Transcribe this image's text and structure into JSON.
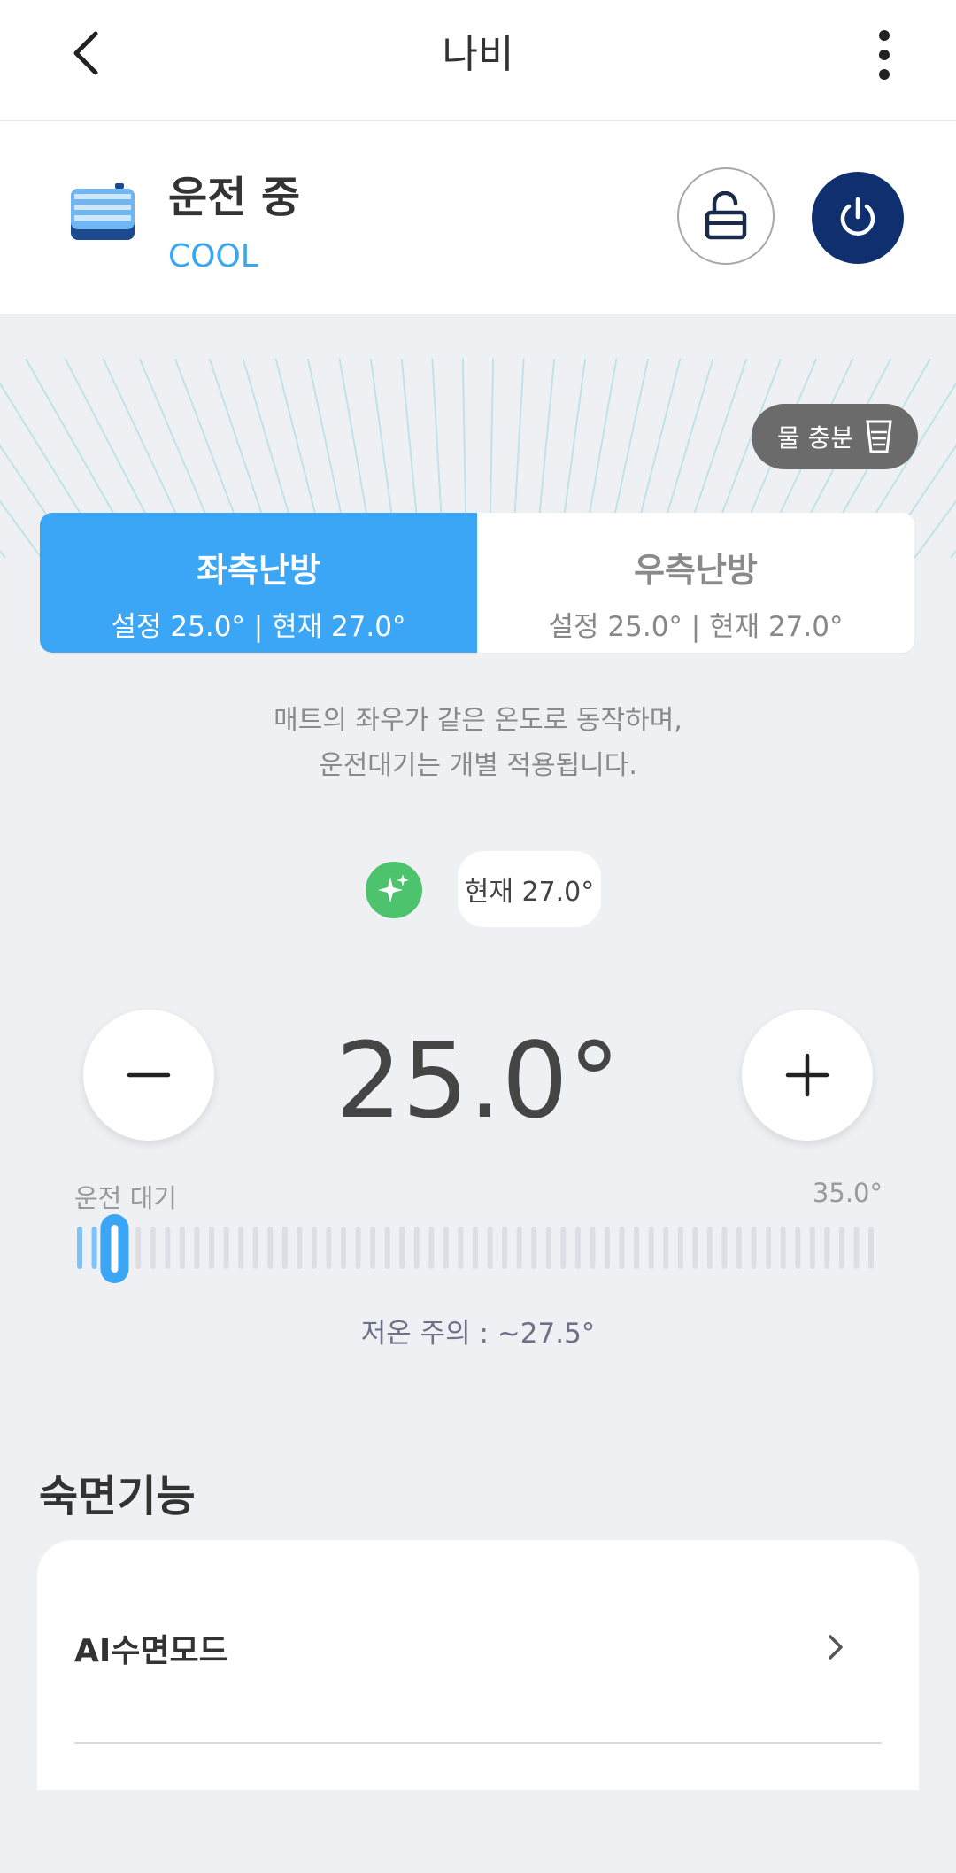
{
  "header": {
    "title": "나비",
    "back_icon": "chevron-left-icon",
    "menu_icon": "more-vertical-icon"
  },
  "status": {
    "state": "운전 중",
    "mode": "COOL",
    "device_icon": "mattress-icon",
    "lock_icon": "unlock-icon",
    "power_icon": "power-icon"
  },
  "water": {
    "label": "물 충분",
    "icon": "water-cup-icon"
  },
  "tabs": [
    {
      "title": "좌측난방",
      "detail": "설정 25.0° | 현재 27.0°",
      "active": true
    },
    {
      "title": "우측난방",
      "detail": "설정 25.0° | 현재 27.0°",
      "active": false
    }
  ],
  "notice": {
    "line1": "매트의 좌우가 같은 온도로 동작하며,",
    "line2": "운전대기는 개별 적용됩니다."
  },
  "current": {
    "label": "현재 27.0°",
    "icon": "sparkle-icon"
  },
  "setpoint": {
    "value": "25.0°",
    "minus_icon": "minus-icon",
    "plus_icon": "plus-icon"
  },
  "slider": {
    "min_label": "운전 대기",
    "max_label": "35.0°",
    "warning": "저온 주의 : ~27.5°",
    "position_fraction": 0.04
  },
  "sleep": {
    "section_title": "숙면기능",
    "items": [
      {
        "label": "AI수면모드"
      }
    ]
  },
  "colors": {
    "accent": "#3aa6f5",
    "power": "#0f2f6e",
    "ai_green": "#4cc36c"
  }
}
